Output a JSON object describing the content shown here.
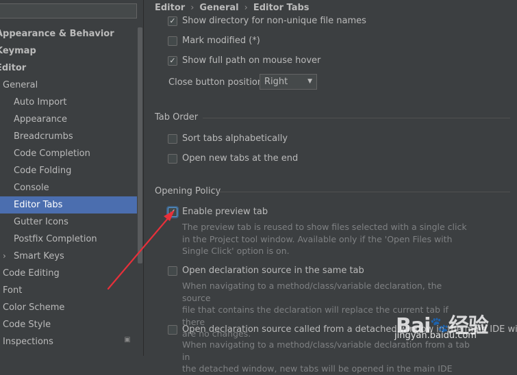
{
  "sidebar": {
    "search": {
      "value": "",
      "placeholder": ""
    },
    "items": [
      {
        "label": "Appearance & Behavior",
        "level": 0,
        "bold": true
      },
      {
        "label": "Keymap",
        "level": 0,
        "bold": true
      },
      {
        "label": "Editor",
        "level": 0,
        "bold": true
      },
      {
        "label": "General",
        "level": 1
      },
      {
        "label": "Auto Import",
        "level": 2
      },
      {
        "label": "Appearance",
        "level": 2
      },
      {
        "label": "Breadcrumbs",
        "level": 2
      },
      {
        "label": "Code Completion",
        "level": 2
      },
      {
        "label": "Code Folding",
        "level": 2
      },
      {
        "label": "Console",
        "level": 2
      },
      {
        "label": "Editor Tabs",
        "level": 2,
        "selected": true
      },
      {
        "label": "Gutter Icons",
        "level": 2
      },
      {
        "label": "Postfix Completion",
        "level": 2
      },
      {
        "label": "Smart Keys",
        "level": 2,
        "chevron": "›"
      },
      {
        "label": "Code Editing",
        "level": 1
      },
      {
        "label": "Font",
        "level": 1
      },
      {
        "label": "Color Scheme",
        "level": 1
      },
      {
        "label": "Code Style",
        "level": 1
      },
      {
        "label": "Inspections",
        "level": 1
      }
    ],
    "selected_color": "#4b6eaf"
  },
  "breadcrumb": [
    "Editor",
    "General",
    "Editor Tabs"
  ],
  "options_top": [
    {
      "label": "Show directory for non-unique file names",
      "checked": true
    },
    {
      "label": "Mark modified (*)",
      "checked": false
    },
    {
      "label": "Show full path on mouse hover",
      "checked": true
    }
  ],
  "close_button": {
    "label": "Close button position:",
    "value": "Right"
  },
  "tab_order": {
    "title": "Tab Order",
    "options": [
      {
        "label": "Sort tabs alphabetically",
        "checked": false
      },
      {
        "label": "Open new tabs at the end",
        "checked": false
      }
    ]
  },
  "opening_policy": {
    "title": "Opening Policy",
    "options": [
      {
        "label": "Enable preview tab",
        "checked": true,
        "description": [
          "The preview tab is reused to show files selected with a single click",
          "in the Project tool window. Available only if the 'Open Files with",
          "Single Click' option is on."
        ]
      },
      {
        "label": "Open declaration source in the same tab",
        "checked": false,
        "description": [
          "When navigating to a method/class/variable declaration, the source",
          "file that contains the declaration will replace the current tab if there",
          "are no changes."
        ]
      },
      {
        "label": "Open declaration source called from a detached window in the main IDE window",
        "checked": false,
        "description": [
          "When navigating to a method/class/variable declaration from a tab in",
          "the detached window, new tabs will be opened in the main IDE"
        ]
      }
    ]
  },
  "watermark": {
    "brand_latin": "Bai",
    "brand_cn": "经验",
    "site": "jingyan.baidu.com"
  },
  "colors": {
    "background": "#3c3f41",
    "text": "#bbbbbb",
    "accent": "#4b6eaf",
    "arrow": "#e8303a"
  }
}
